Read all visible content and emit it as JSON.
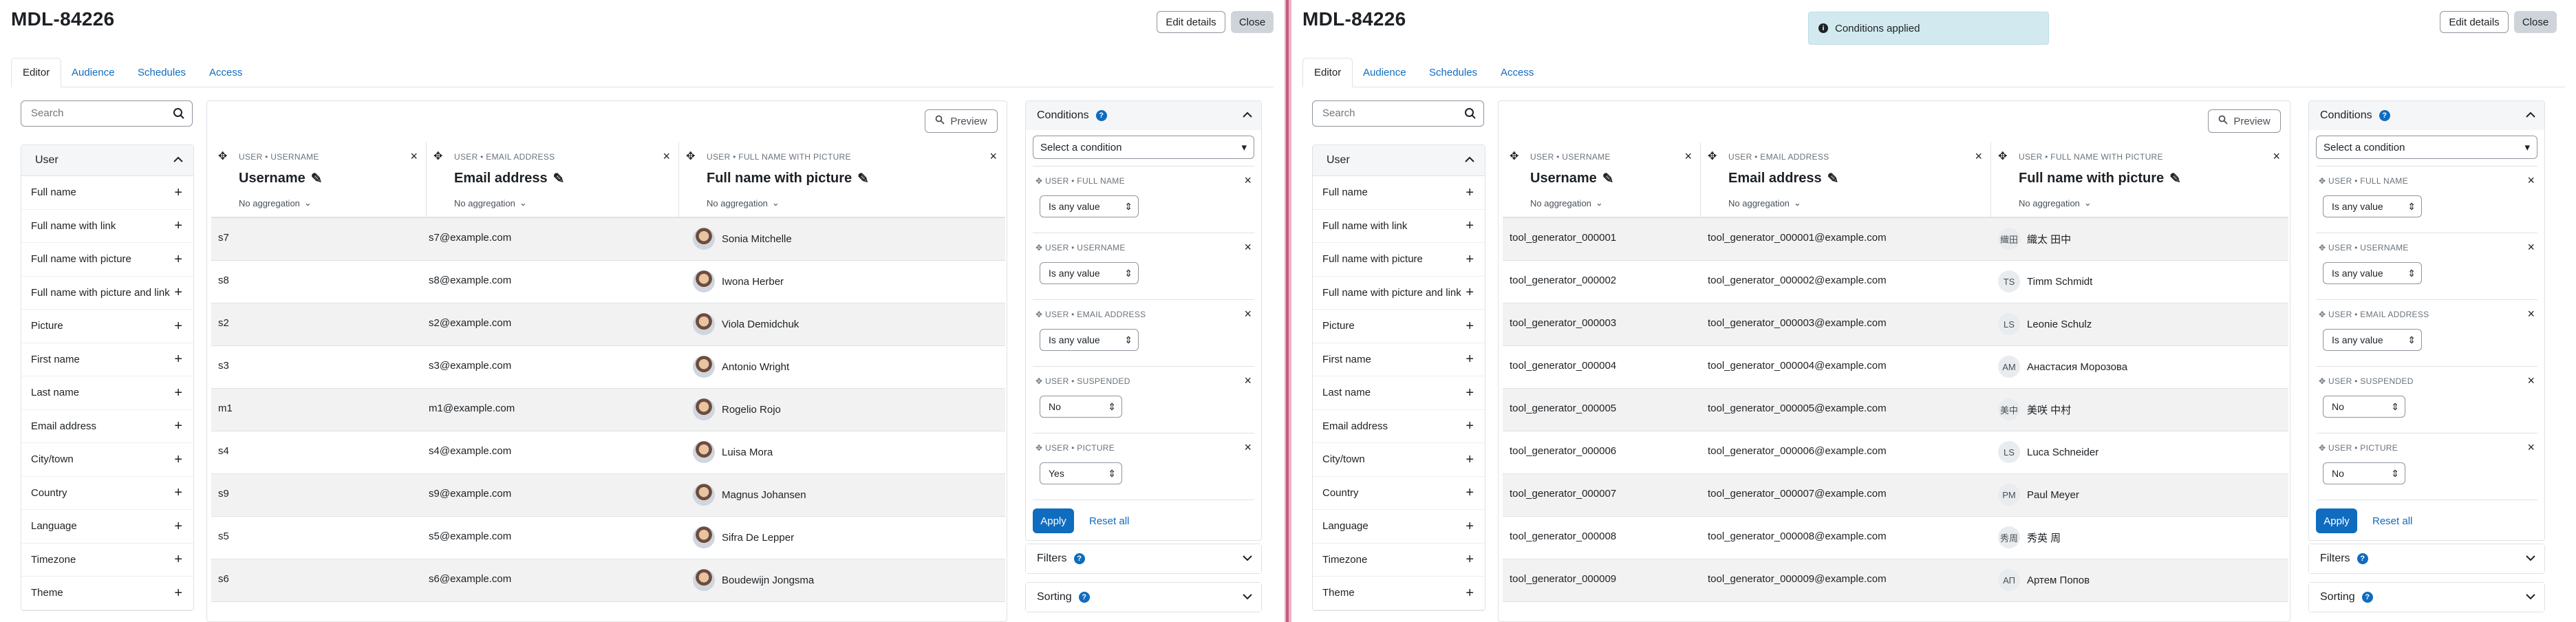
{
  "title": "MDL-84226",
  "buttons": {
    "edit": "Edit details",
    "close": "Close",
    "preview": "Preview",
    "apply": "Apply",
    "reset": "Reset all"
  },
  "tabs": [
    "Editor",
    "Audience",
    "Schedules",
    "Access"
  ],
  "search": {
    "placeholder": "Search"
  },
  "sidebar": {
    "category": "User",
    "items": [
      "Full name",
      "Full name with link",
      "Full name with picture",
      "Full name with picture and link",
      "Picture",
      "First name",
      "Last name",
      "Email address",
      "City/town",
      "Country",
      "Language",
      "Timezone",
      "Theme"
    ]
  },
  "columns": [
    {
      "kicker": "USER • USERNAME",
      "title": "Username",
      "agg": "No aggregation"
    },
    {
      "kicker": "USER • EMAIL ADDRESS",
      "title": "Email address",
      "agg": "No aggregation"
    },
    {
      "kicker": "USER • FULL NAME WITH PICTURE",
      "title": "Full name with picture",
      "agg": "No aggregation"
    }
  ],
  "conditions": {
    "title": "Conditions",
    "select_placeholder": "Select a condition",
    "items": [
      {
        "label": "USER • FULL NAME",
        "value": "Is any value"
      },
      {
        "label": "USER • USERNAME",
        "value": "Is any value"
      },
      {
        "label": "USER • EMAIL ADDRESS",
        "value": "Is any value"
      },
      {
        "label": "USER • SUSPENDED",
        "value": "No"
      },
      {
        "label": "USER • PICTURE",
        "left_value": "Yes",
        "right_value": "No"
      }
    ]
  },
  "filters": {
    "title": "Filters"
  },
  "sorting": {
    "title": "Sorting"
  },
  "toast": "Conditions applied",
  "left_rows": [
    {
      "username": "s7",
      "email": "s7@example.com",
      "name": "Sonia Mitchelle"
    },
    {
      "username": "s8",
      "email": "s8@example.com",
      "name": "Iwona Herber"
    },
    {
      "username": "s2",
      "email": "s2@example.com",
      "name": "Viola Demidchuk"
    },
    {
      "username": "s3",
      "email": "s3@example.com",
      "name": "Antonio Wright"
    },
    {
      "username": "m1",
      "email": "m1@example.com",
      "name": "Rogelio Rojo"
    },
    {
      "username": "s4",
      "email": "s4@example.com",
      "name": "Luisa Mora"
    },
    {
      "username": "s9",
      "email": "s9@example.com",
      "name": "Magnus Johansen"
    },
    {
      "username": "s5",
      "email": "s5@example.com",
      "name": "Sifra De Lepper"
    },
    {
      "username": "s6",
      "email": "s6@example.com",
      "name": "Boudewijn Jongsma"
    }
  ],
  "right_rows": [
    {
      "username": "tool_generator_000001",
      "email": "tool_generator_000001@example.com",
      "initials": "織田",
      "name": "織太 田中"
    },
    {
      "username": "tool_generator_000002",
      "email": "tool_generator_000002@example.com",
      "initials": "TS",
      "name": "Timm Schmidt"
    },
    {
      "username": "tool_generator_000003",
      "email": "tool_generator_000003@example.com",
      "initials": "LS",
      "name": "Leonie Schulz"
    },
    {
      "username": "tool_generator_000004",
      "email": "tool_generator_000004@example.com",
      "initials": "AM",
      "name": "Анастасия Морозова"
    },
    {
      "username": "tool_generator_000005",
      "email": "tool_generator_000005@example.com",
      "initials": "美中",
      "name": "美咲 中村"
    },
    {
      "username": "tool_generator_000006",
      "email": "tool_generator_000006@example.com",
      "initials": "LS",
      "name": "Luca Schneider"
    },
    {
      "username": "tool_generator_000007",
      "email": "tool_generator_000007@example.com",
      "initials": "PM",
      "name": "Paul Meyer"
    },
    {
      "username": "tool_generator_000008",
      "email": "tool_generator_000008@example.com",
      "initials": "秀周",
      "name": "秀英 周"
    },
    {
      "username": "tool_generator_000009",
      "email": "tool_generator_000009@example.com",
      "initials": "АП",
      "name": "Артем Попов"
    }
  ]
}
